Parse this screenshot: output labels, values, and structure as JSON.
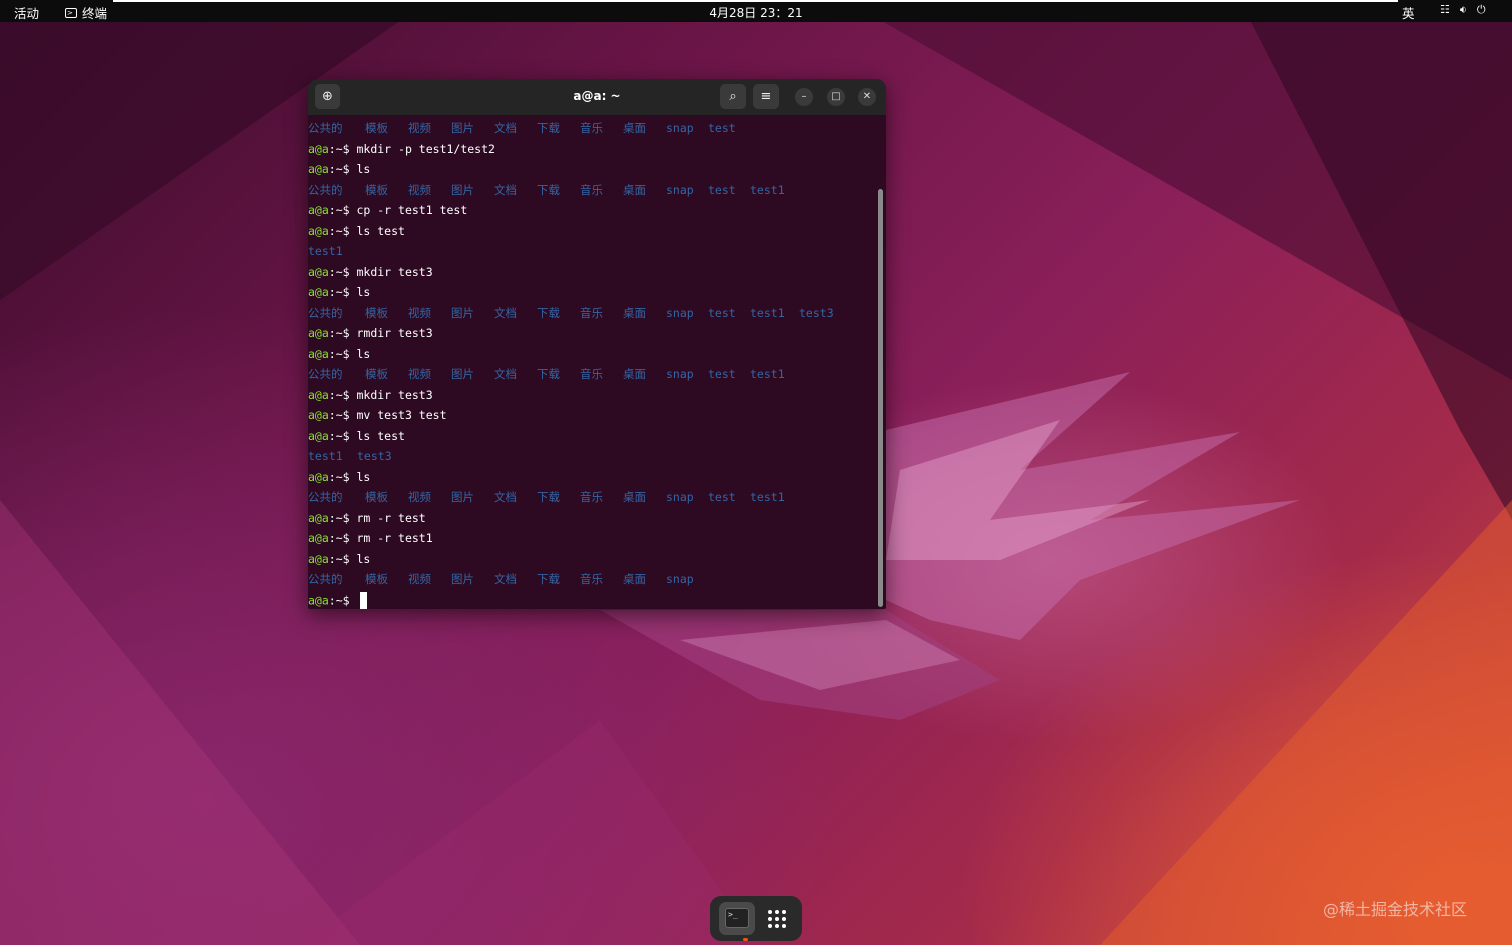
{
  "topbar": {
    "activities": "活动",
    "app_name": "终端",
    "clock": "4月28日  23：21",
    "input_method": "英",
    "tray_icons": [
      "network-icon",
      "volume-icon",
      "power-icon"
    ]
  },
  "terminal": {
    "title": "a@a: ~",
    "prompt_user": "a@a",
    "prompt_sep": ":~$",
    "cursor_prompt": "a@a:~$",
    "lines": [
      {
        "type": "out",
        "items": [
          "公共的",
          "模板",
          "视频",
          "图片",
          "文档",
          "下载",
          "音乐",
          "桌面",
          "snap",
          "test"
        ]
      },
      {
        "type": "cmd",
        "text": "mkdir -p test1/test2"
      },
      {
        "type": "cmd",
        "text": "ls"
      },
      {
        "type": "out",
        "items": [
          "公共的",
          "模板",
          "视频",
          "图片",
          "文档",
          "下载",
          "音乐",
          "桌面",
          "snap",
          "test",
          "test1"
        ]
      },
      {
        "type": "cmd",
        "text": "cp -r test1 test"
      },
      {
        "type": "cmd",
        "text": "ls test"
      },
      {
        "type": "out",
        "items": [
          "test1"
        ]
      },
      {
        "type": "cmd",
        "text": "mkdir test3"
      },
      {
        "type": "cmd",
        "text": "ls"
      },
      {
        "type": "out",
        "items": [
          "公共的",
          "模板",
          "视频",
          "图片",
          "文档",
          "下载",
          "音乐",
          "桌面",
          "snap",
          "test",
          "test1",
          "test3"
        ]
      },
      {
        "type": "cmd",
        "text": "rmdir test3"
      },
      {
        "type": "cmd",
        "text": "ls"
      },
      {
        "type": "out",
        "items": [
          "公共的",
          "模板",
          "视频",
          "图片",
          "文档",
          "下载",
          "音乐",
          "桌面",
          "snap",
          "test",
          "test1"
        ]
      },
      {
        "type": "cmd",
        "text": "mkdir test3"
      },
      {
        "type": "cmd",
        "text": "mv test3 test"
      },
      {
        "type": "cmd",
        "text": "ls test"
      },
      {
        "type": "out",
        "items": [
          "test1",
          "test3"
        ]
      },
      {
        "type": "cmd",
        "text": "ls"
      },
      {
        "type": "out",
        "items": [
          "公共的",
          "模板",
          "视频",
          "图片",
          "文档",
          "下载",
          "音乐",
          "桌面",
          "snap",
          "test",
          "test1"
        ]
      },
      {
        "type": "cmd",
        "text": "rm -r test"
      },
      {
        "type": "cmd",
        "text": "rm -r test1"
      },
      {
        "type": "cmd",
        "text": "ls"
      },
      {
        "type": "out",
        "items": [
          "公共的",
          "模板",
          "视频",
          "图片",
          "文档",
          "下载",
          "音乐",
          "桌面",
          "snap"
        ]
      }
    ]
  },
  "dock": {
    "apps": [
      "terminal-icon",
      "app-grid-icon"
    ]
  },
  "watermark": "@稀土掘金技术社区",
  "colors": {
    "prompt": "#8ae234",
    "dir": "#3465a4",
    "terminal_bg": "#2d0a22",
    "accent": "#e95420"
  }
}
